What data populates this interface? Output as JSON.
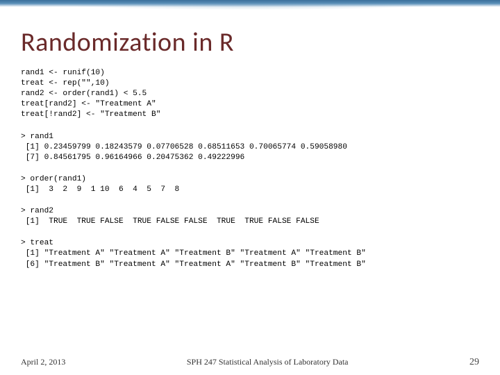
{
  "title": "Randomization in R",
  "code": {
    "setup": "rand1 <- runif(10)\ntreat <- rep(\"\",10)\nrand2 <- order(rand1) < 5.5\ntreat[rand2] <- \"Treatment A\"\ntreat[!rand2] <- \"Treatment B\"",
    "rand1_out": "> rand1\n [1] 0.23459799 0.18243579 0.07706528 0.68511653 0.70065774 0.59058980\n [7] 0.84561795 0.96164966 0.20475362 0.49222996",
    "order_out": "> order(rand1)\n [1]  3  2  9  1 10  6  4  5  7  8",
    "rand2_out": "> rand2\n [1]  TRUE  TRUE FALSE  TRUE FALSE FALSE  TRUE  TRUE FALSE FALSE",
    "treat_out": "> treat\n [1] \"Treatment A\" \"Treatment A\" \"Treatment B\" \"Treatment A\" \"Treatment B\"\n [6] \"Treatment B\" \"Treatment A\" \"Treatment A\" \"Treatment B\" \"Treatment B\""
  },
  "footer": {
    "date": "April 2, 2013",
    "course": "SPH 247 Statistical Analysis of Laboratory Data",
    "page": "29"
  }
}
